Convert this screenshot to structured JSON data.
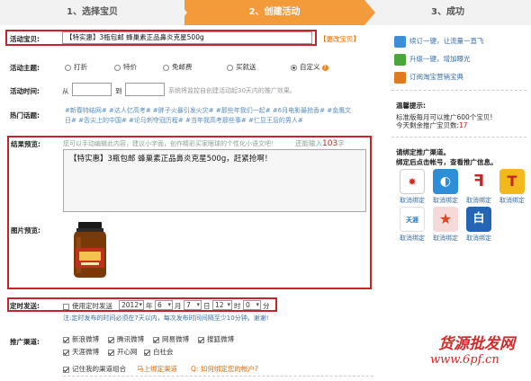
{
  "steps": [
    {
      "label": "1、选择宝贝"
    },
    {
      "label": "2、创建活动"
    },
    {
      "label": "3、成功"
    }
  ],
  "form": {
    "title_label": "活动宝贝:",
    "title_value": "【特实惠】3瓶包邮 蜂巢素正品鼻炎克星500g",
    "change_link": "【更改宝贝】",
    "theme_label": "活动主题:",
    "themes": [
      "打折",
      "特价",
      "免邮费",
      "买就送",
      "自定义"
    ],
    "time_label": "活动时间:",
    "time_from": "从",
    "time_to": "到",
    "time_hint": "系统将监控自创建活动起30天内的推广效果。",
    "topic_label": "热门话题:",
    "topics_line1": "#新春特结网#  #达人忆高考#  #胖子火暴引发火灾#  #那些年我们一起#  #6月电影最抢香#  #金鹰文",
    "topics_line2": "日#  #舌尖上的中国#  #论马刺夺冠历程#  #当年我高考那些事#  #仁显王后的男人#",
    "preview_label": "结果预览:",
    "preview_hint": "您可以手动编辑此内容，建议小字面，创作精彩买家眼球的个性化小语文吧！",
    "count_prefix": "还能输入",
    "count_value": "103",
    "count_suffix": "字",
    "preview_text": "【特实惠】3瓶包邮 蜂巢素正品鼻炎克星500g，赶紧抢啊！",
    "image_label": "图片预览:",
    "timed_label": "定时发送:",
    "timed_checkbox": "使用定时发送",
    "timed_year": "2012",
    "timed_year_unit": "年",
    "timed_month": "6",
    "timed_month_unit": "月",
    "timed_day": "7",
    "timed_day_unit": "日",
    "timed_hour": "12",
    "timed_hour_unit": "时",
    "timed_min": "0",
    "timed_min_unit": "分",
    "timed_hint": "注:定时发布的时间必须在7天以内，每次发布时间间隔至少10分钟。谢谢!",
    "channel_label": "推广渠道:",
    "channels_row1": [
      "新浪微博",
      "腾讯微博",
      "网易微博",
      "搜狐微博"
    ],
    "channels_row2": [
      "天涯微博",
      "开心网",
      "白社会"
    ],
    "remember": "记住我的渠道组合",
    "bind_link": "马上绑定渠道",
    "question_link": "Q: 如何绑定您的帐户?"
  },
  "side": {
    "link1": "续订一键，让流量一直飞",
    "link2": "升级一键，增加曝光",
    "link3": "订阅淘宝营销宝典",
    "tips_title": "温馨提示:",
    "tips_line2": "标准版每月可以推广600个宝贝!",
    "tips_line3_prefix": "今天剩余推广宝贝数:",
    "tips_line3_value": "17",
    "bind_title": "请绑定推广渠道。",
    "bind_sub": "绑定后点击帐号，查看推广信息。",
    "unbind": "取消绑定"
  },
  "watermark": {
    "line1": "货源批发网",
    "line2": "www.6pf.cn"
  },
  "colors": {
    "accent": "#f39a3a",
    "highlight_box": "#c8222a",
    "link": "#3a6ea5"
  }
}
